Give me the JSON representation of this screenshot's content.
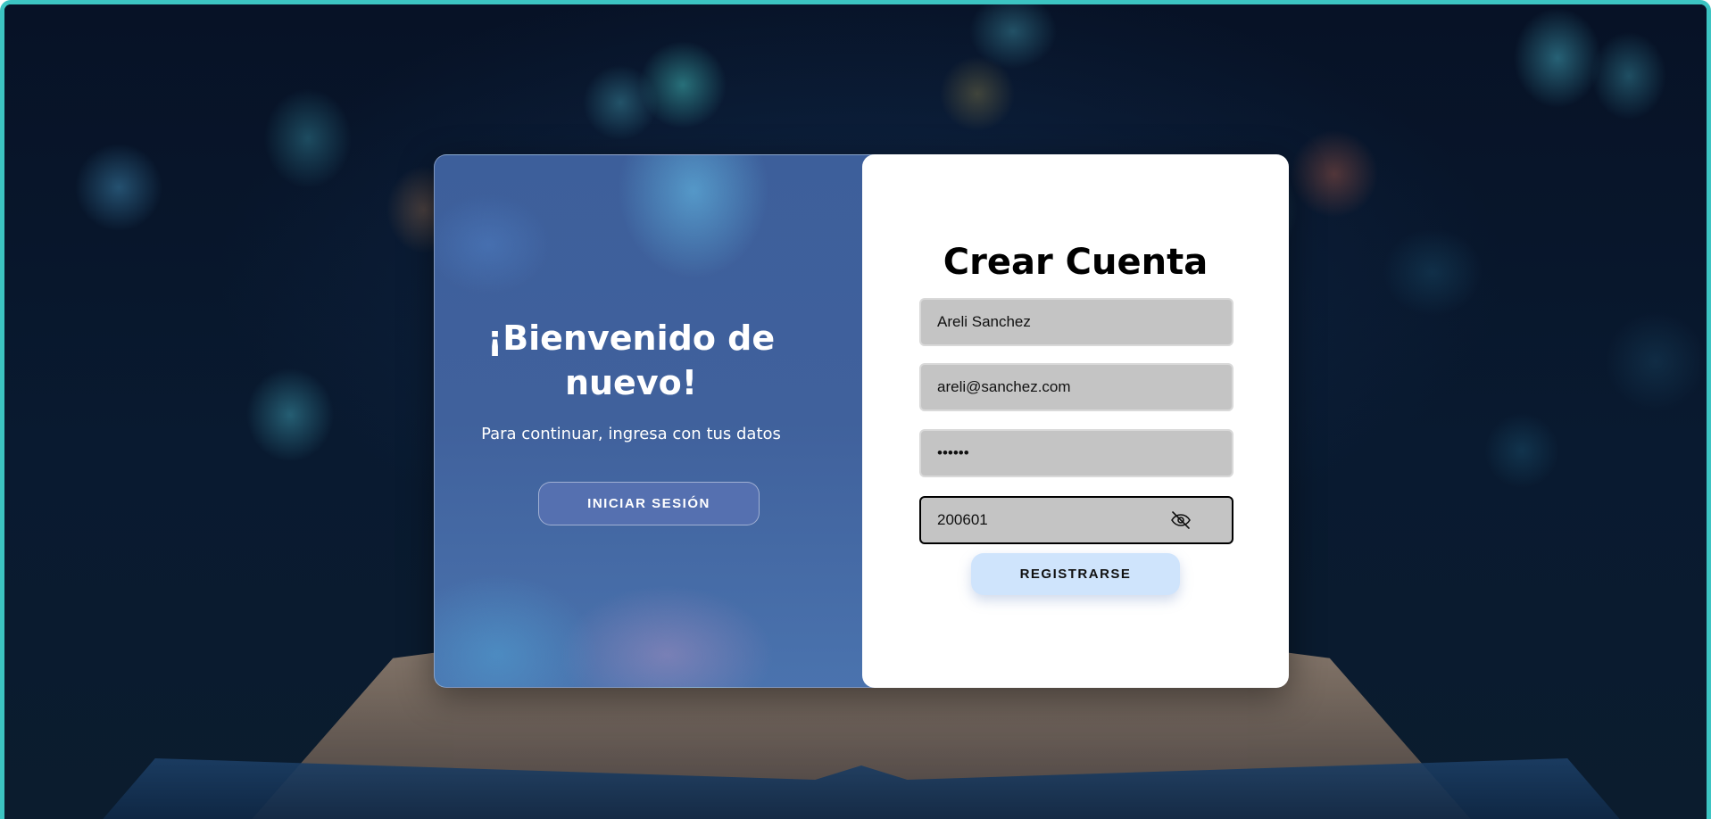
{
  "left_panel": {
    "title": "¡Bienvenido de nuevo!",
    "subtitle": "Para continuar, ingresa con tus datos",
    "login_button": "INICIAR SESIÓN"
  },
  "register_form": {
    "title": "Crear Cuenta",
    "name_value": "Areli Sanchez",
    "email_value": "areli@sanchez.com",
    "password_value": "••••••",
    "confirm_value": "200601",
    "toggle_icon": "eye-off-icon",
    "register_button": "REGISTRARSE"
  },
  "colors": {
    "frame_border": "#3cc4c2",
    "left_panel": "#40619c",
    "register_button": "#cfe4fc",
    "field_background": "#c4c4c4"
  }
}
